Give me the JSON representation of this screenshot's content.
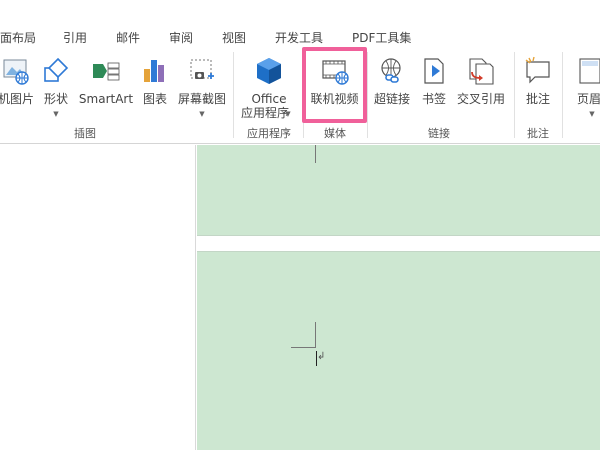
{
  "tabs": [
    "面布局",
    "引用",
    "邮件",
    "审阅",
    "视图",
    "开发工具",
    "PDF工具集"
  ],
  "ribbon": {
    "buttons": {
      "online_picture": "机图片",
      "shapes": "形状",
      "smartart": "SmartArt",
      "chart": "图表",
      "screenshot": "屏幕截图",
      "office_line1": "Office",
      "office_line2": "应用程序",
      "online_video": "联机视频",
      "hyperlink": "超链接",
      "bookmark": "书签",
      "cross_reference": "交叉引用",
      "comment": "批注",
      "header": "页眉"
    },
    "groups": {
      "illustrations": "插图",
      "apps": "应用程序",
      "media": "媒体",
      "links": "链接",
      "comments": "批注"
    }
  },
  "document": {
    "paragraph_mark": "↲"
  },
  "colors": {
    "highlight_border": "#f0609a",
    "page_background": "#cde7d1",
    "office_icon": "#1e6fc7"
  }
}
